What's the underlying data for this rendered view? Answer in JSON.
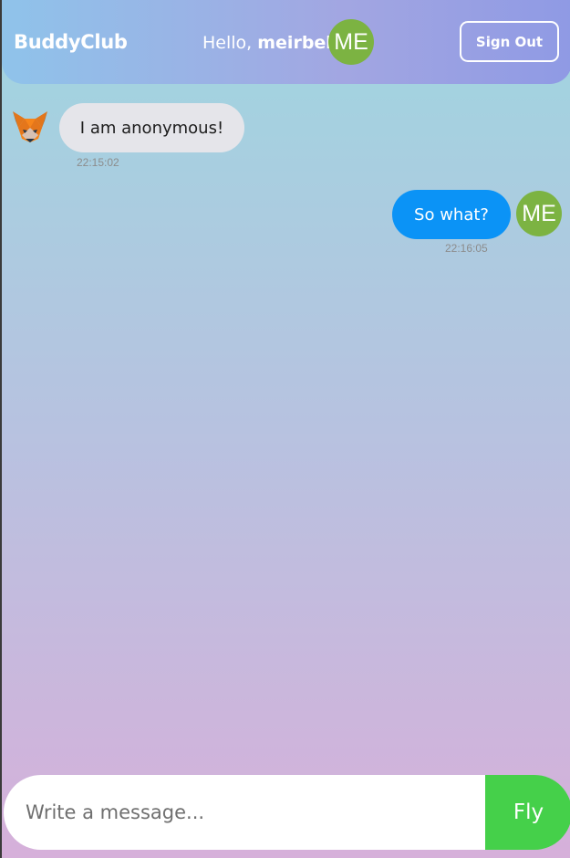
{
  "header": {
    "brand": "BuddyClub",
    "greeting_prefix": "Hello, ",
    "username": "meirbek",
    "avatar_initials": "ME",
    "sign_out_label": "Sign Out"
  },
  "messages": [
    {
      "direction": "received",
      "text": "I am anonymous!",
      "time": "22:15:02",
      "avatar_icon": "fox-icon"
    },
    {
      "direction": "sent",
      "text": "So what?",
      "time": "22:16:05",
      "avatar_initials": "ME"
    }
  ],
  "composer": {
    "placeholder": "Write a message...",
    "value": "",
    "send_label": "Fly"
  },
  "colors": {
    "received_bubble": "#e5e5ea",
    "sent_bubble": "#0b93f6",
    "avatar": "#7cb342",
    "send_button": "#45d04a"
  }
}
